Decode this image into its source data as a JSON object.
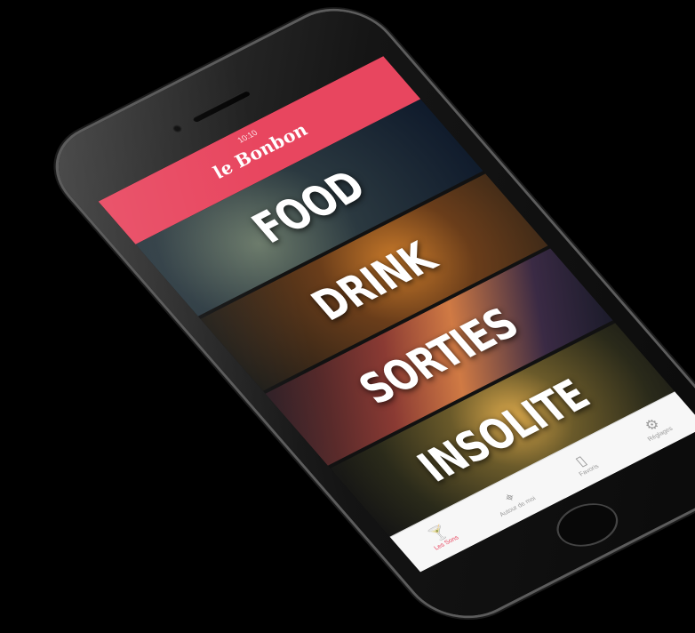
{
  "status": {
    "time": "10:10"
  },
  "app": {
    "logo": "le Bonbon",
    "header_color": "#e8465f"
  },
  "categories": [
    {
      "label": "FOOD"
    },
    {
      "label": "DRINK"
    },
    {
      "label": "SORTIES"
    },
    {
      "label": "INSOLITE"
    }
  ],
  "tabbar": {
    "tabs": [
      {
        "label": "Les Sons",
        "icon": "glass-icon",
        "active": true
      },
      {
        "label": "Autour de moi",
        "icon": "map-pin-icon",
        "active": false
      },
      {
        "label": "Favoris",
        "icon": "bookmark-icon",
        "active": false
      },
      {
        "label": "Réglages",
        "icon": "gear-icon",
        "active": false
      }
    ]
  }
}
